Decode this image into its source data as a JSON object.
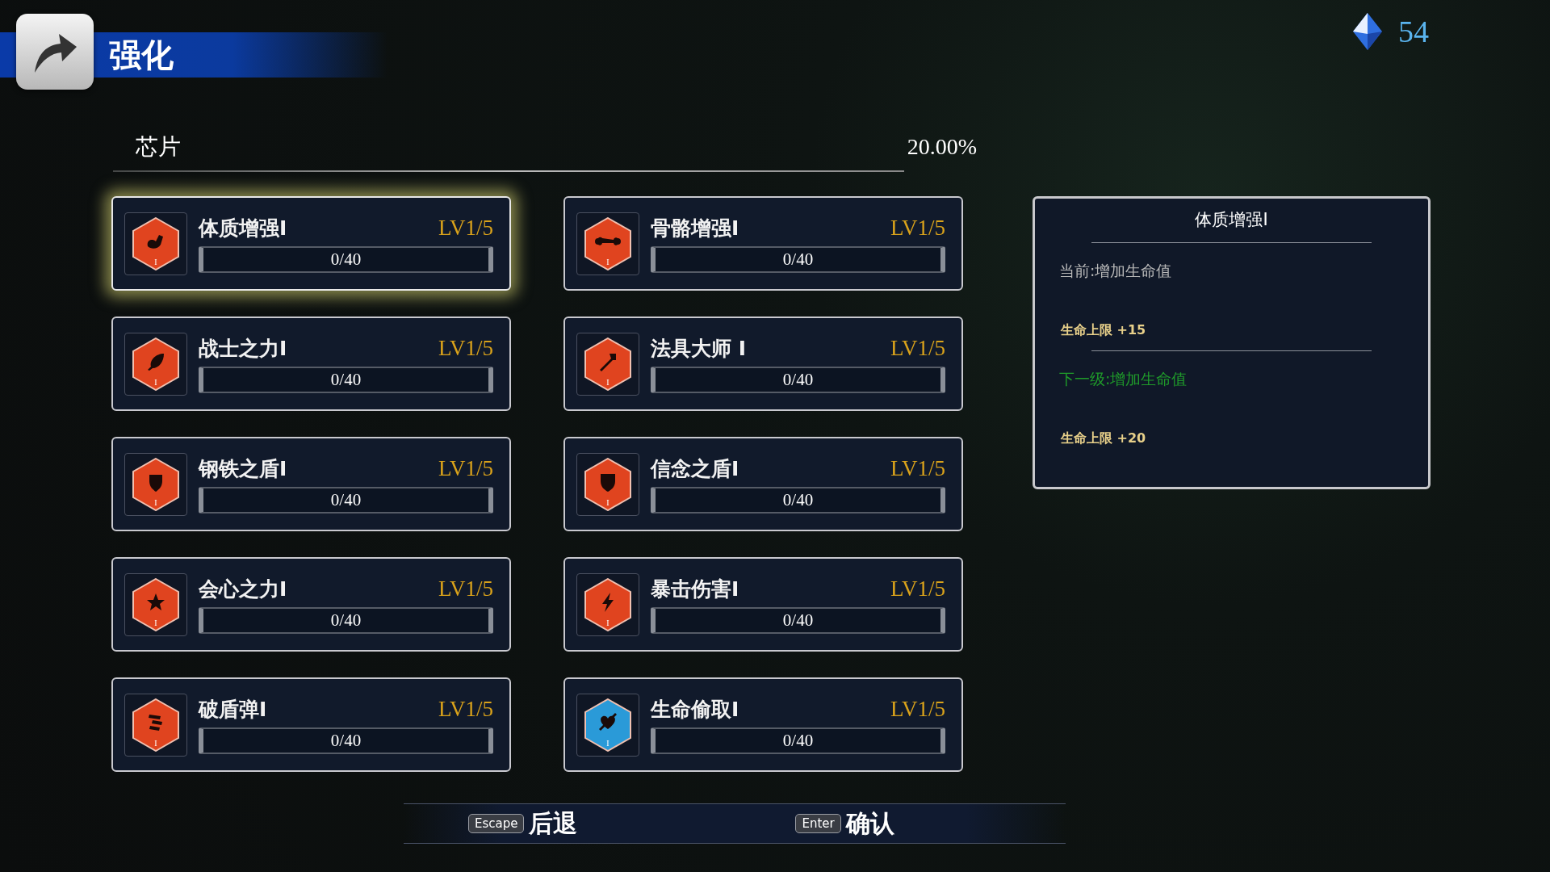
{
  "header": {
    "title": "强化",
    "currency": "54"
  },
  "section": {
    "label": "芯片",
    "percent": "20.00%"
  },
  "skills": [
    {
      "name": "体质增强I",
      "level_text": "LV1/5",
      "progress": "0/40",
      "level": 0,
      "tier": "I",
      "color": "#e0441f",
      "selected": true
    },
    {
      "name": "骨骼增强I",
      "level_text": "LV1/5",
      "progress": "0/40",
      "level": 0,
      "tier": "I",
      "color": "#e0441f",
      "selected": false
    },
    {
      "name": "战士之力I",
      "level_text": "LV1/5",
      "progress": "0/40",
      "level": 0,
      "tier": "I",
      "color": "#e0441f",
      "selected": false
    },
    {
      "name": "法具大师 I",
      "level_text": "LV1/5",
      "progress": "0/40",
      "level": 0,
      "tier": "I",
      "color": "#e0441f",
      "selected": false
    },
    {
      "name": "钢铁之盾I",
      "level_text": "LV1/5",
      "progress": "0/40",
      "level": 0,
      "tier": "I",
      "color": "#e0441f",
      "selected": false
    },
    {
      "name": "信念之盾I",
      "level_text": "LV1/5",
      "progress": "0/40",
      "level": 0,
      "tier": "I",
      "color": "#e0441f",
      "selected": false
    },
    {
      "name": "会心之力I",
      "level_text": "LV1/5",
      "progress": "0/40",
      "level": 0,
      "tier": "I",
      "color": "#e0441f",
      "selected": false
    },
    {
      "name": "暴击伤害I",
      "level_text": "LV1/5",
      "progress": "0/40",
      "level": 0,
      "tier": "I",
      "color": "#e0441f",
      "selected": false
    },
    {
      "name": "破盾弹I",
      "level_text": "LV1/5",
      "progress": "0/40",
      "level": 0,
      "tier": "I",
      "color": "#e0441f",
      "selected": false
    },
    {
      "name": "生命偷取I",
      "level_text": "LV1/5",
      "progress": "0/40",
      "level": 0,
      "tier": "I",
      "color": "#2a9ad8",
      "selected": false
    }
  ],
  "detail": {
    "title": "体质增强I",
    "current_label": "当前:增加生命值",
    "current_effect": "生命上限 +15",
    "next_label": "下一级:增加生命值",
    "next_effect": "生命上限 +20"
  },
  "footer": [
    {
      "key": "Escape",
      "label": "后退"
    },
    {
      "key": "Enter",
      "label": "确认"
    }
  ]
}
